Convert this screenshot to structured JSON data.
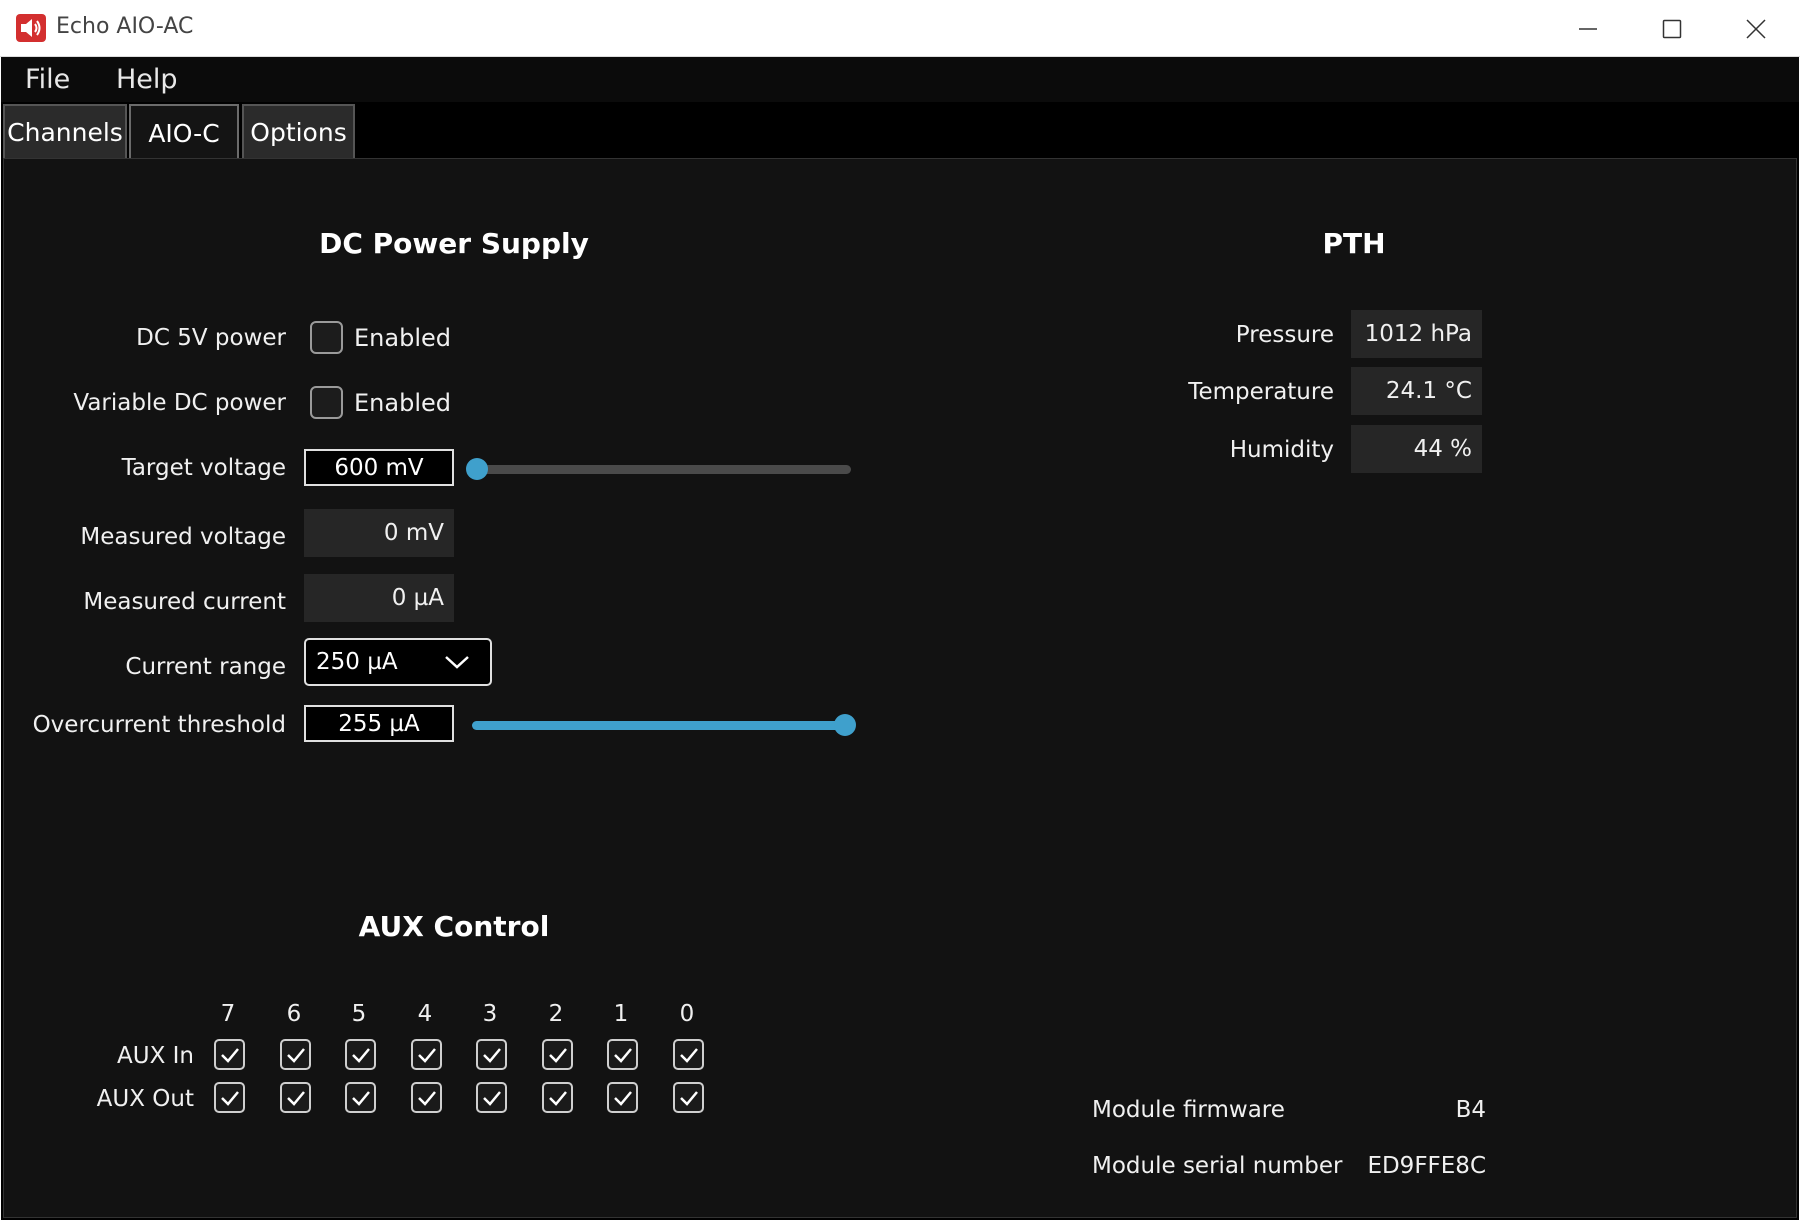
{
  "window": {
    "title": "Echo AIO-AC"
  },
  "menu": {
    "file": "File",
    "help": "Help"
  },
  "tabs": [
    {
      "label": "Channels"
    },
    {
      "label": "AIO-C",
      "active": true
    },
    {
      "label": "Options"
    }
  ],
  "dc": {
    "heading": "DC Power Supply",
    "dc5v_label": "DC 5V power",
    "dc5v_checkbox": "Enabled",
    "variable_label": "Variable DC power",
    "variable_checkbox": "Enabled",
    "target_label": "Target voltage",
    "target_value": "600 mV",
    "target_slider_fraction": 0.0,
    "measured_voltage_label": "Measured voltage",
    "measured_voltage_value": "0 mV",
    "measured_current_label": "Measured current",
    "measured_current_value": "0 µA",
    "range_label": "Current range",
    "range_value": "250 µA",
    "overcurrent_label": "Overcurrent threshold",
    "overcurrent_value": "255 µA",
    "overcurrent_slider_fraction": 1.0
  },
  "pth": {
    "heading": "PTH",
    "pressure_label": "Pressure",
    "pressure_value": "1012 hPa",
    "temperature_label": "Temperature",
    "temperature_value": "24.1 °C",
    "humidity_label": "Humidity",
    "humidity_value": "44 %"
  },
  "aux": {
    "heading": "AUX Control",
    "columns": [
      "7",
      "6",
      "5",
      "4",
      "3",
      "2",
      "1",
      "0"
    ],
    "in_label": "AUX In",
    "out_label": "AUX Out"
  },
  "module": {
    "firmware_label": "Module firmware",
    "firmware_value": "B4",
    "serial_label": "Module serial number",
    "serial_value": "ED9FFE8C"
  },
  "colors": {
    "accent": "#3fa0cc",
    "background": "#121212",
    "track": "#4a4a4a"
  }
}
